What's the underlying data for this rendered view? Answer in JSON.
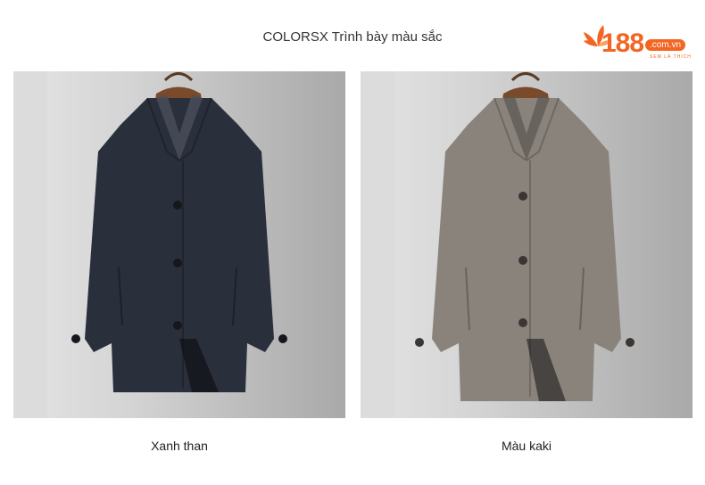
{
  "header": {
    "title": "COLORSX Trình bày màu sắc"
  },
  "logo": {
    "number": "188",
    "domain": ".com.vn",
    "tagline": "SEM LÀ THÍCH",
    "accent_color": "#f26522"
  },
  "products": [
    {
      "caption": "Xanh than",
      "coat_color": "#2a2f3c"
    },
    {
      "caption": "Màu kaki",
      "coat_color": "#8a837c"
    }
  ]
}
